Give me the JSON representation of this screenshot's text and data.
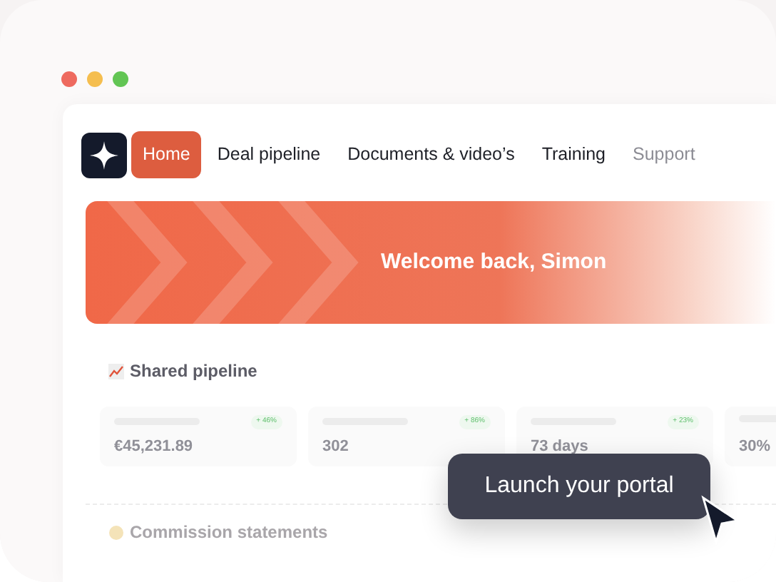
{
  "window": {
    "controls": [
      {
        "color": "#ee6a5f"
      },
      {
        "color": "#f5be4f"
      },
      {
        "color": "#62c554"
      }
    ]
  },
  "nav": {
    "tabs": [
      {
        "label": "Home",
        "selected": true
      },
      {
        "label": "Deal pipeline",
        "selected": false
      },
      {
        "label": "Documents & video’s",
        "selected": false
      },
      {
        "label": "Training",
        "selected": false
      },
      {
        "label": "Support",
        "selected": false
      }
    ]
  },
  "banner": {
    "title": "Welcome back, Simon"
  },
  "shared_pipeline": {
    "title": "Shared pipeline",
    "stats": [
      {
        "value": "€45,231.89",
        "change": "+ 46%"
      },
      {
        "value": "302",
        "change": "+ 86%"
      },
      {
        "value": "73 days",
        "change": "+ 23%"
      },
      {
        "value": "30%"
      }
    ]
  },
  "commission": {
    "title": "Commission statements"
  },
  "tooltip": {
    "text": "Launch your portal"
  }
}
